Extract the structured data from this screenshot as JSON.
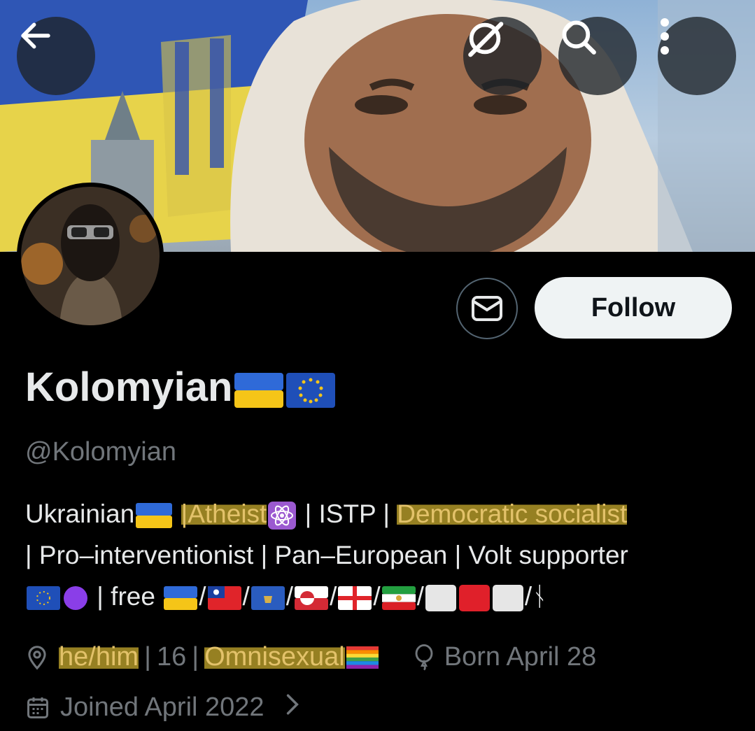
{
  "header": {
    "back_icon": "arrow-left-icon",
    "grok_icon": "grok-icon",
    "search_icon": "search-icon",
    "more_icon": "more-vertical-icon"
  },
  "profile": {
    "display_name": "Kolomyian",
    "name_flags": [
      "ukraine-flag",
      "eu-flag"
    ],
    "handle": "@Kolomyian",
    "follow_label": "Follow",
    "message_icon": "envelope-icon"
  },
  "bio": {
    "line1": {
      "a": "Ukrainian",
      "b": "|",
      "c": "Atheist",
      "d": "| ISTP |",
      "e": "Democratic socialist"
    },
    "line2": "| Pro–interventionist | Pan–European | Volt supporter",
    "line3": {
      "a": "| free",
      "sep": "/",
      "end": "/ᚾ"
    }
  },
  "meta": {
    "pronouns": "he/him",
    "pipe": "|",
    "age": "16",
    "orientation": "Omnisexual",
    "birthday": "Born April 28",
    "joined": "Joined April 2022"
  },
  "colors": {
    "background": "#000000",
    "text": "#e7e9ea",
    "muted": "#71767b",
    "highlight": "#b0962a",
    "follow_bg": "#eff3f4"
  }
}
